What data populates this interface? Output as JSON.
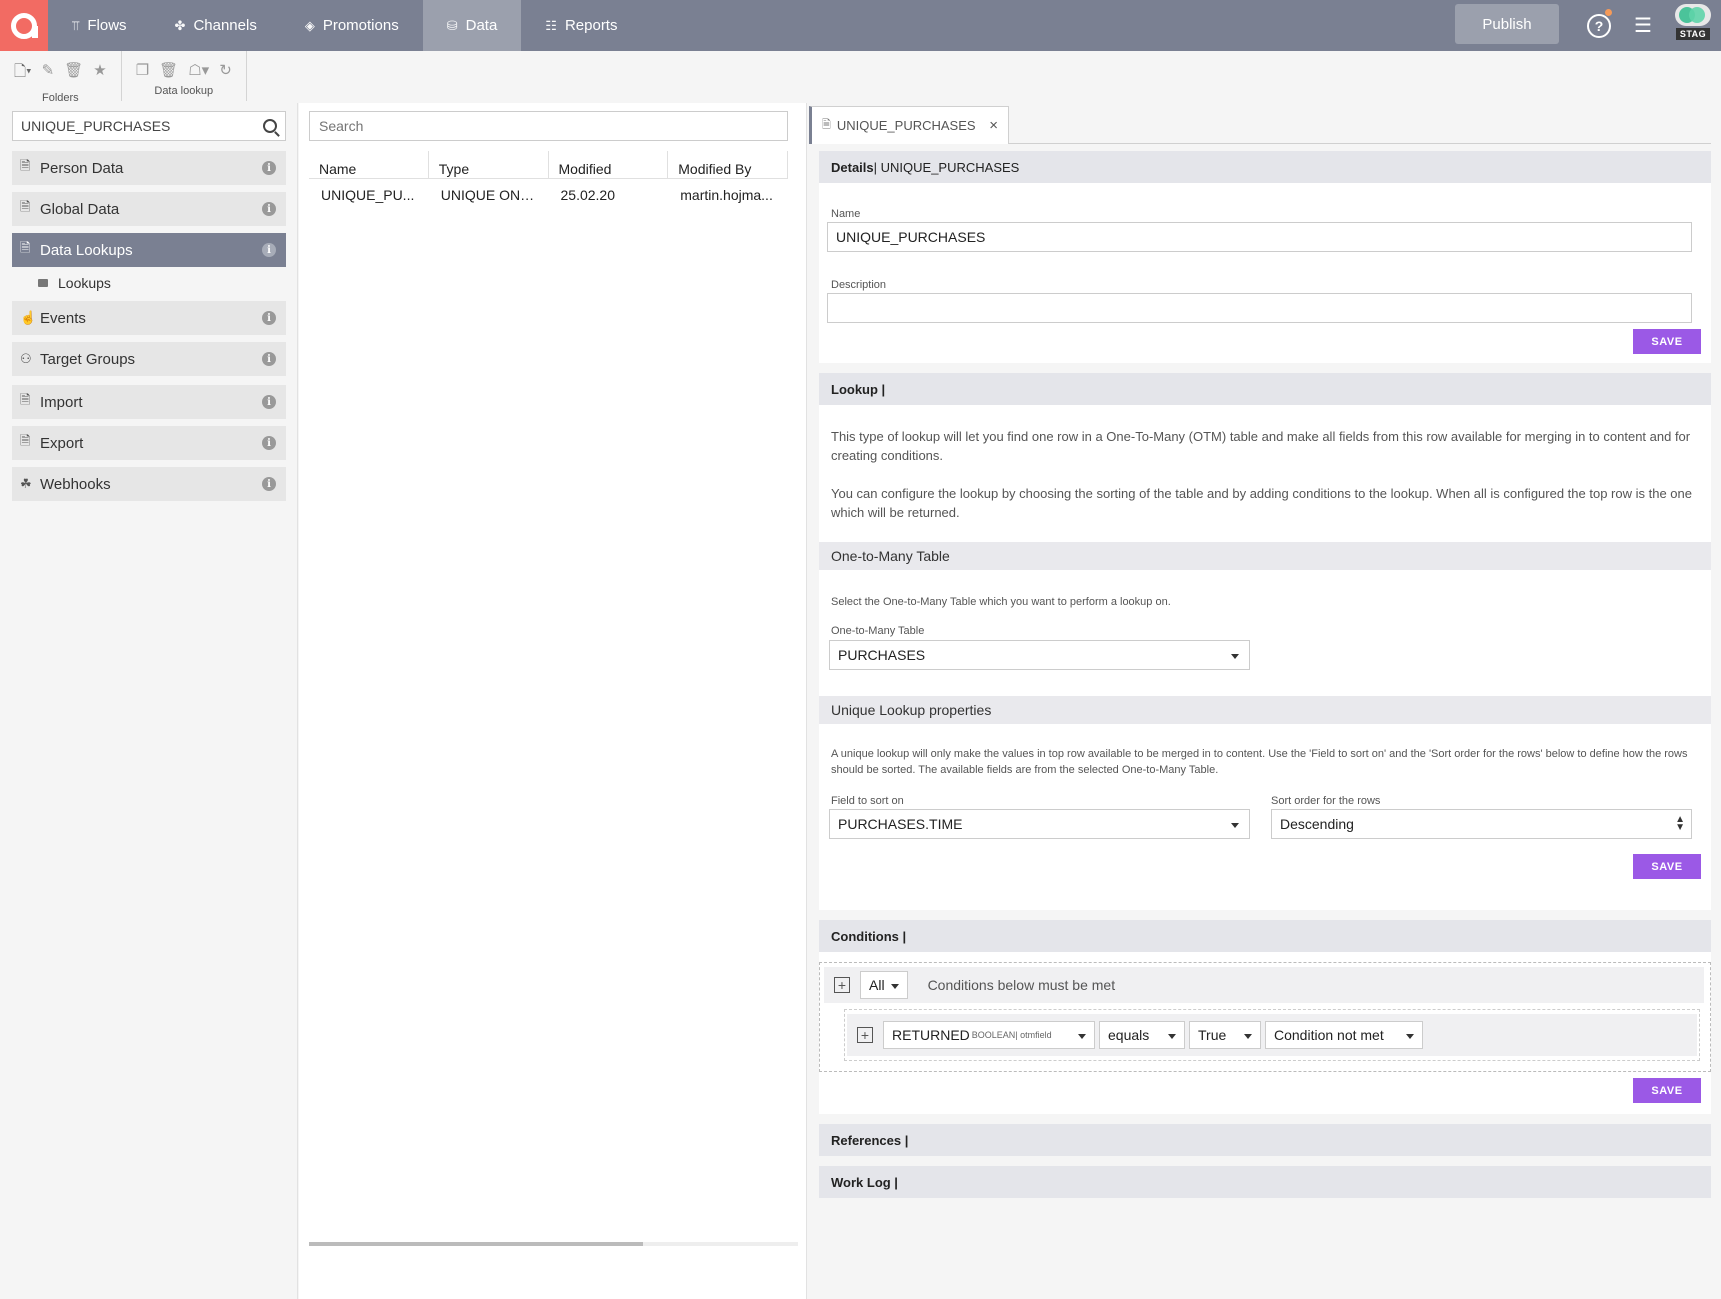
{
  "nav": {
    "items": [
      {
        "label": "Flows",
        "icon": "flows-icon"
      },
      {
        "label": "Channels",
        "icon": "channels-icon"
      },
      {
        "label": "Promotions",
        "icon": "promotions-icon"
      },
      {
        "label": "Data",
        "icon": "database-icon"
      },
      {
        "label": "Reports",
        "icon": "reports-icon"
      }
    ],
    "active": "Data",
    "publish_label": "Publish",
    "env_label": "STAG"
  },
  "toolbar": {
    "folders_label": "Folders",
    "datalookup_label": "Data lookup"
  },
  "left": {
    "search_value": "UNIQUE_PURCHASES",
    "categories": [
      {
        "label": "Person Data",
        "icon": "person-data-icon"
      },
      {
        "label": "Global Data",
        "icon": "global-data-icon"
      },
      {
        "label": "Data Lookups",
        "icon": "data-lookups-icon",
        "active": true
      },
      {
        "label": "Events",
        "icon": "events-icon"
      },
      {
        "label": "Target Groups",
        "icon": "target-groups-icon"
      },
      {
        "label": "Import",
        "icon": "import-icon"
      },
      {
        "label": "Export",
        "icon": "export-icon"
      },
      {
        "label": "Webhooks",
        "icon": "webhooks-icon"
      }
    ],
    "subfolder": "Lookups"
  },
  "middle": {
    "search_placeholder": "Search",
    "columns": [
      "Name",
      "Type",
      "Modified",
      "Modified By"
    ],
    "rows": [
      [
        "UNIQUE_PU...",
        "UNIQUE ONE...",
        "25.02.20",
        "martin.hojma..."
      ]
    ]
  },
  "detail": {
    "tab_label": "UNIQUE_PURCHASES",
    "details_head_bold": "Details",
    "details_head_rest": " | UNIQUE_PURCHASES",
    "name_label": "Name",
    "name_value": "UNIQUE_PURCHASES",
    "description_label": "Description",
    "description_value": "",
    "save_label": "SAVE",
    "lookup_head": "Lookup |",
    "lookup_para1": "This type of lookup will let you find one row in a One-To-Many (OTM) table and make all fields from this row available for merging in to content and for creating conditions.",
    "lookup_para2": "You can configure the lookup by choosing the sorting of the table and by adding conditions to the lookup. When all is configured the top row is the one which will be returned.",
    "otm_head": "One-to-Many Table",
    "otm_para": "Select the One-to-Many Table which you want to perform a lookup on.",
    "otm_label": "One-to-Many Table",
    "otm_value": "PURCHASES",
    "unique_head": "Unique Lookup properties",
    "unique_para": "A unique lookup will only make the values in top row available to be merged in to content. Use the 'Field to sort on' and the 'Sort order for the rows' below to define how the rows should be sorted. The available fields are from the selected One-to-Many Table.",
    "sort_field_label": "Field to sort on",
    "sort_field_value": "PURCHASES.TIME",
    "sort_order_label": "Sort order for the rows",
    "sort_order_value": "Descending",
    "conditions_head": "Conditions |",
    "cond_all": "All",
    "cond_desc": "Conditions below must be met",
    "cond_field": "RETURNED",
    "cond_field_type": "BOOLEAN",
    "cond_field_source": "| otmfield",
    "cond_op": "equals",
    "cond_value": "True",
    "cond_fallback": "Condition not met",
    "references_head": "References |",
    "worklog_head": "Work Log |"
  }
}
